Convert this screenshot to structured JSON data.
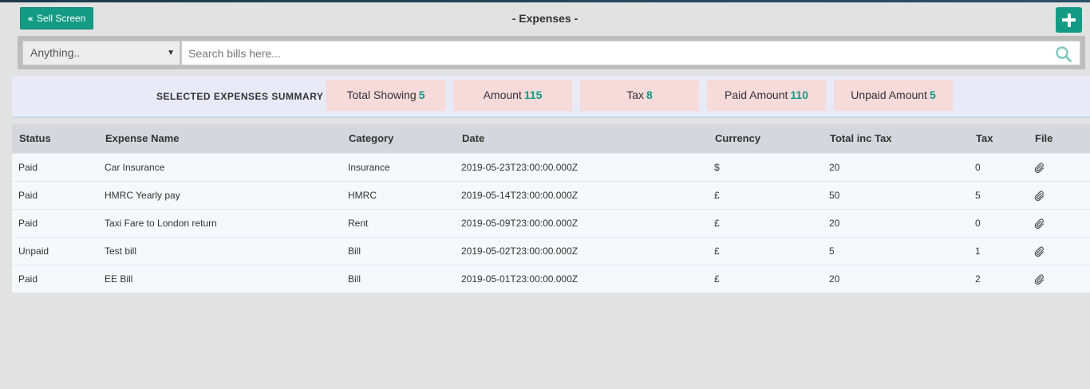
{
  "header": {
    "back_label": "Sell Screen",
    "title": "- Expenses -"
  },
  "search": {
    "filter_value": "Anything..",
    "placeholder": "Search bills here..."
  },
  "summary": {
    "title": "SELECTED EXPENSES SUMMARY",
    "cards": [
      {
        "label": "Total Showing",
        "value": "5"
      },
      {
        "label": "Amount",
        "value": "115"
      },
      {
        "label": "Tax",
        "value": "8"
      },
      {
        "label": "Paid Amount",
        "value": "110"
      },
      {
        "label": "Unpaid Amount",
        "value": "5"
      }
    ]
  },
  "table": {
    "columns": [
      "Status",
      "Expense Name",
      "Category",
      "Date",
      "Currency",
      "Total inc Tax",
      "Tax",
      "File"
    ],
    "rows": [
      {
        "status": "Paid",
        "name": "Car Insurance",
        "category": "Insurance",
        "date": "2019-05-23T23:00:00.000Z",
        "currency": "$",
        "total": "20",
        "tax": "0"
      },
      {
        "status": "Paid",
        "name": "HMRC Yearly pay",
        "category": "HMRC",
        "date": "2019-05-14T23:00:00.000Z",
        "currency": "£",
        "total": "50",
        "tax": "5"
      },
      {
        "status": "Paid",
        "name": "Taxi Fare to London return",
        "category": "Rent",
        "date": "2019-05-09T23:00:00.000Z",
        "currency": "£",
        "total": "20",
        "tax": "0"
      },
      {
        "status": "Unpaid",
        "name": "Test bill",
        "category": "Bill",
        "date": "2019-05-02T23:00:00.000Z",
        "currency": "£",
        "total": "5",
        "tax": "1"
      },
      {
        "status": "Paid",
        "name": "EE Bill",
        "category": "Bill",
        "date": "2019-05-01T23:00:00.000Z",
        "currency": "£",
        "total": "20",
        "tax": "2"
      }
    ]
  },
  "colors": {
    "accent": "#139b85",
    "summary_card": "#f7dada",
    "summary_bar": "#e9eaf7",
    "table_header": "#d4d7dc"
  },
  "icons": {
    "back": "double-chevron-left-icon",
    "add": "plus-icon",
    "search": "search-icon",
    "file": "paperclip-icon"
  }
}
